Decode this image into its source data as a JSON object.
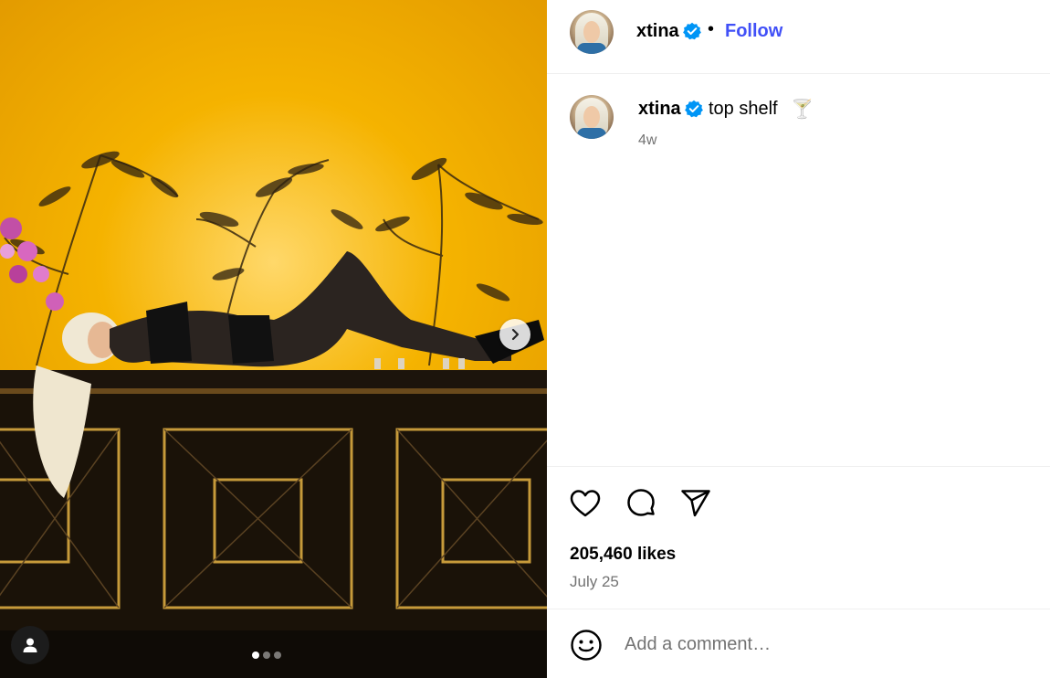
{
  "post": {
    "username": "xtina",
    "follow_label": "Follow",
    "separator": "•",
    "caption": "top shelf",
    "caption_emoji": "🍸",
    "time_ago": "4w",
    "likes": "205,460 likes",
    "date": "July 25",
    "verified": true
  },
  "carousel": {
    "slide_count": 3,
    "active_index": 0
  },
  "actions": {
    "icons": [
      "heart-icon",
      "comment-icon",
      "share-icon"
    ]
  },
  "comment": {
    "placeholder": "Add a comment…"
  },
  "colors": {
    "accent": "#4150f7",
    "verified": "#0095f6",
    "muted": "#737373"
  }
}
